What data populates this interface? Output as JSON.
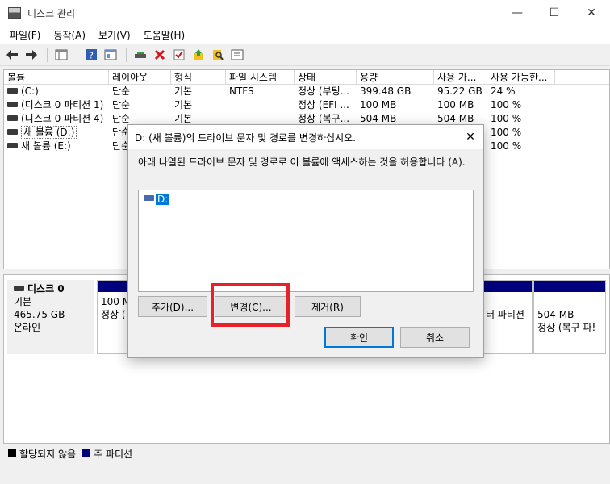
{
  "window": {
    "title": "디스크 관리"
  },
  "menu": [
    "파일(F)",
    "동작(A)",
    "보기(V)",
    "도움말(H)"
  ],
  "columns": [
    "볼륨",
    "레이아웃",
    "형식",
    "파일 시스템",
    "상태",
    "용량",
    "사용 가...",
    "사용 가능한..."
  ],
  "volumes": [
    [
      "(C:)",
      "단순",
      "기본",
      "NTFS",
      "정상 (부팅...",
      "399.48 GB",
      "95.22 GB",
      "24 %"
    ],
    [
      "(디스크 0 파티션 1)",
      "단순",
      "기본",
      "",
      "정상 (EFI ...",
      "100 MB",
      "100 MB",
      "100 %"
    ],
    [
      "(디스크 0 파티션 4)",
      "단순",
      "기본",
      "",
      "정상 (복구...",
      "504 MB",
      "504 MB",
      "100 %"
    ],
    [
      "새 볼륨 (D:)",
      "단순",
      "",
      "",
      "",
      "",
      "",
      "100 %"
    ],
    [
      "새 볼륨 (E:)",
      "단순",
      "",
      "",
      "",
      "",
      "",
      "100 %"
    ]
  ],
  "disk": {
    "name": "디스크 0",
    "type": "기본",
    "size": "465.75 GB",
    "status": "온라인"
  },
  "partitions": {
    "p1": {
      "line1": "100 M",
      "line2": "정상 ("
    },
    "p2": {
      "line1": "",
      "line2": "터 파티션"
    },
    "p3": {
      "line1": "504 MB",
      "line2": "정상 (복구 파!"
    }
  },
  "legend": {
    "unallocated": "할당되지 않음",
    "primary": "주 파티션"
  },
  "dialog": {
    "title": "D: (새 볼륨)의 드라이브 문자 및 경로를 변경하십시오.",
    "description": "아래 나열된 드라이브 문자 및 경로로 이 볼륨에 액세스하는 것을 허용합니다 (A).",
    "item": "D:",
    "add_label": "추가(D)...",
    "change_label": "변경(C)...",
    "remove_label": "제거(R)",
    "ok_label": "확인",
    "cancel_label": "취소"
  },
  "colors": {
    "primary_partition": "#00007e",
    "unallocated": "#000000",
    "highlight": "#e8202a",
    "accent": "#0078d7"
  }
}
